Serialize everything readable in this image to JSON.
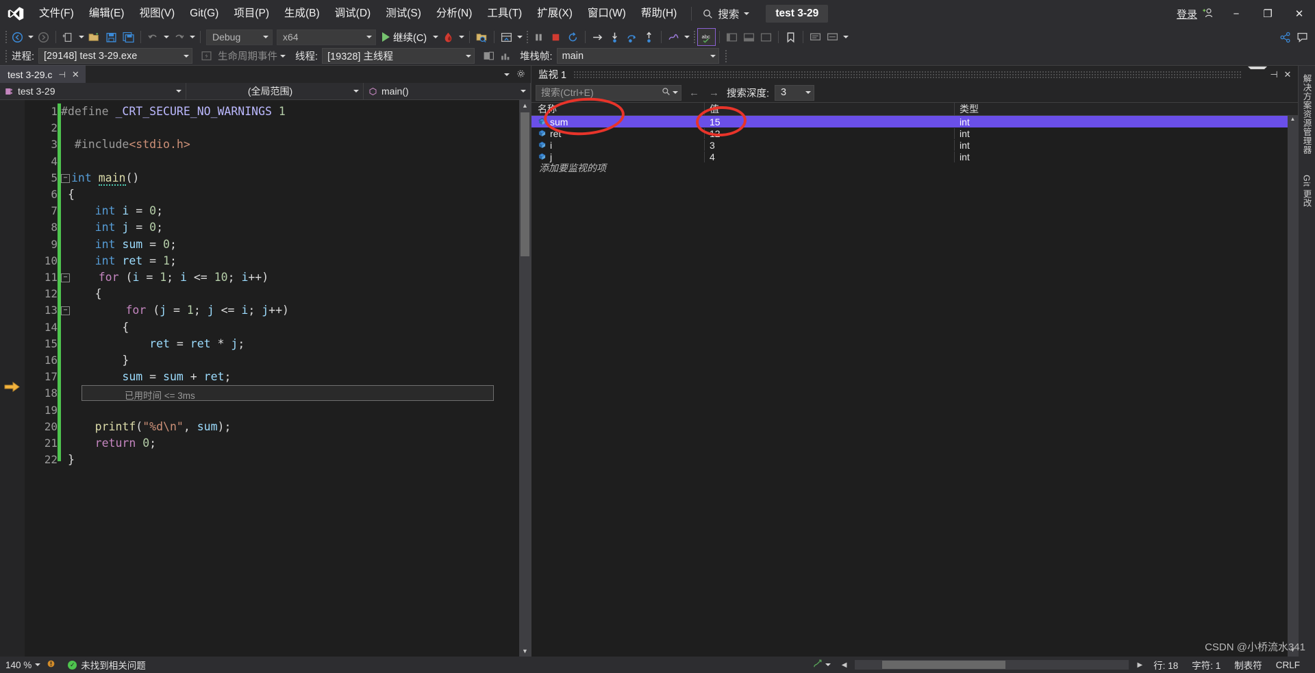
{
  "window": {
    "logo": "vs-logo",
    "solution_chip": "test 3-29",
    "signin_label": "登录",
    "minimize": "−",
    "restore": "❐",
    "close": "✕"
  },
  "menu": {
    "items": [
      {
        "label": "文件(F)"
      },
      {
        "label": "编辑(E)"
      },
      {
        "label": "视图(V)"
      },
      {
        "label": "Git(G)"
      },
      {
        "label": "项目(P)"
      },
      {
        "label": "生成(B)"
      },
      {
        "label": "调试(D)"
      },
      {
        "label": "测试(S)"
      },
      {
        "label": "分析(N)"
      },
      {
        "label": "工具(T)"
      },
      {
        "label": "扩展(X)"
      },
      {
        "label": "窗口(W)"
      },
      {
        "label": "帮助(H)"
      }
    ],
    "search_label": "搜索"
  },
  "toolbar": {
    "config": "Debug",
    "platform": "x64",
    "run_label": "继续(C)",
    "icons": [
      "navigate-backward-icon",
      "navigate-forward-icon",
      "new-project-icon",
      "open-file-icon",
      "save-icon",
      "save-all-icon",
      "undo-icon",
      "redo-icon"
    ]
  },
  "processbar": {
    "process_label": "进程:",
    "process_value": "[29148] test 3-29.exe",
    "lifecycle_label": "生命周期事件",
    "thread_label": "线程:",
    "thread_value": "[19328] 主线程",
    "stackframe_label": "堆栈帧:",
    "stackframe_value": "main"
  },
  "editor": {
    "tab_title": "test 3-29.c",
    "nav_project": "test 3-29",
    "nav_scope": "(全局范围)",
    "nav_function": "main()",
    "current_line": 18,
    "elapsed_annotation": "已用时间 <= 3ms",
    "lines": [
      {
        "n": 1,
        "text": "#define _CRT_SECURE_NO_WARNINGS 1"
      },
      {
        "n": 2,
        "text": ""
      },
      {
        "n": 3,
        "text": "#include<stdio.h>"
      },
      {
        "n": 4,
        "text": ""
      },
      {
        "n": 5,
        "text": "int main()"
      },
      {
        "n": 6,
        "text": "{"
      },
      {
        "n": 7,
        "text": "    int i = 0;"
      },
      {
        "n": 8,
        "text": "    int j = 0;"
      },
      {
        "n": 9,
        "text": "    int sum = 0;"
      },
      {
        "n": 10,
        "text": "    int ret = 1;"
      },
      {
        "n": 11,
        "text": "    for (i = 1; i <= 10; i++)"
      },
      {
        "n": 12,
        "text": "    {"
      },
      {
        "n": 13,
        "text": "        for (j = 1; j <= i; j++)"
      },
      {
        "n": 14,
        "text": "        {"
      },
      {
        "n": 15,
        "text": "            ret = ret * j;"
      },
      {
        "n": 16,
        "text": "        }"
      },
      {
        "n": 17,
        "text": "        sum = sum + ret;"
      },
      {
        "n": 18,
        "text": "    }"
      },
      {
        "n": 19,
        "text": ""
      },
      {
        "n": 20,
        "text": "    printf(\"%d\\n\", sum);"
      },
      {
        "n": 21,
        "text": "    return 0;"
      },
      {
        "n": 22,
        "text": "}"
      }
    ]
  },
  "watch": {
    "title": "监视 1",
    "search_placeholder": "搜索(Ctrl+E)",
    "depth_label": "搜索深度:",
    "depth_value": "3",
    "columns": [
      "名称",
      "值",
      "类型"
    ],
    "rows": [
      {
        "name": "sum",
        "value": "15",
        "type": "int",
        "selected": true
      },
      {
        "name": "ret",
        "value": "12",
        "type": "int",
        "selected": false
      },
      {
        "name": "i",
        "value": "3",
        "type": "int",
        "selected": false
      },
      {
        "name": "j",
        "value": "4",
        "type": "int",
        "selected": false
      }
    ],
    "add_row": "添加要监视的项"
  },
  "sidetabs": [
    {
      "label": "解决方案资源管理器"
    },
    {
      "label": "Git 更改"
    }
  ],
  "statusbar": {
    "zoom": "140 %",
    "problems": "未找到相关问题",
    "line": "行: 18",
    "column": "字符: 1",
    "tabs": "制表符",
    "eol": "CRLF"
  },
  "watermark": "CSDN @小桥流水341",
  "colors": {
    "accent_selection": "#6a4fe8",
    "changebar_green": "#4ec44e",
    "annotation_red": "#e8342a",
    "run_green": "#76c36f",
    "chrome": "#2d2d30",
    "editor_bg": "#1e1e1e"
  }
}
